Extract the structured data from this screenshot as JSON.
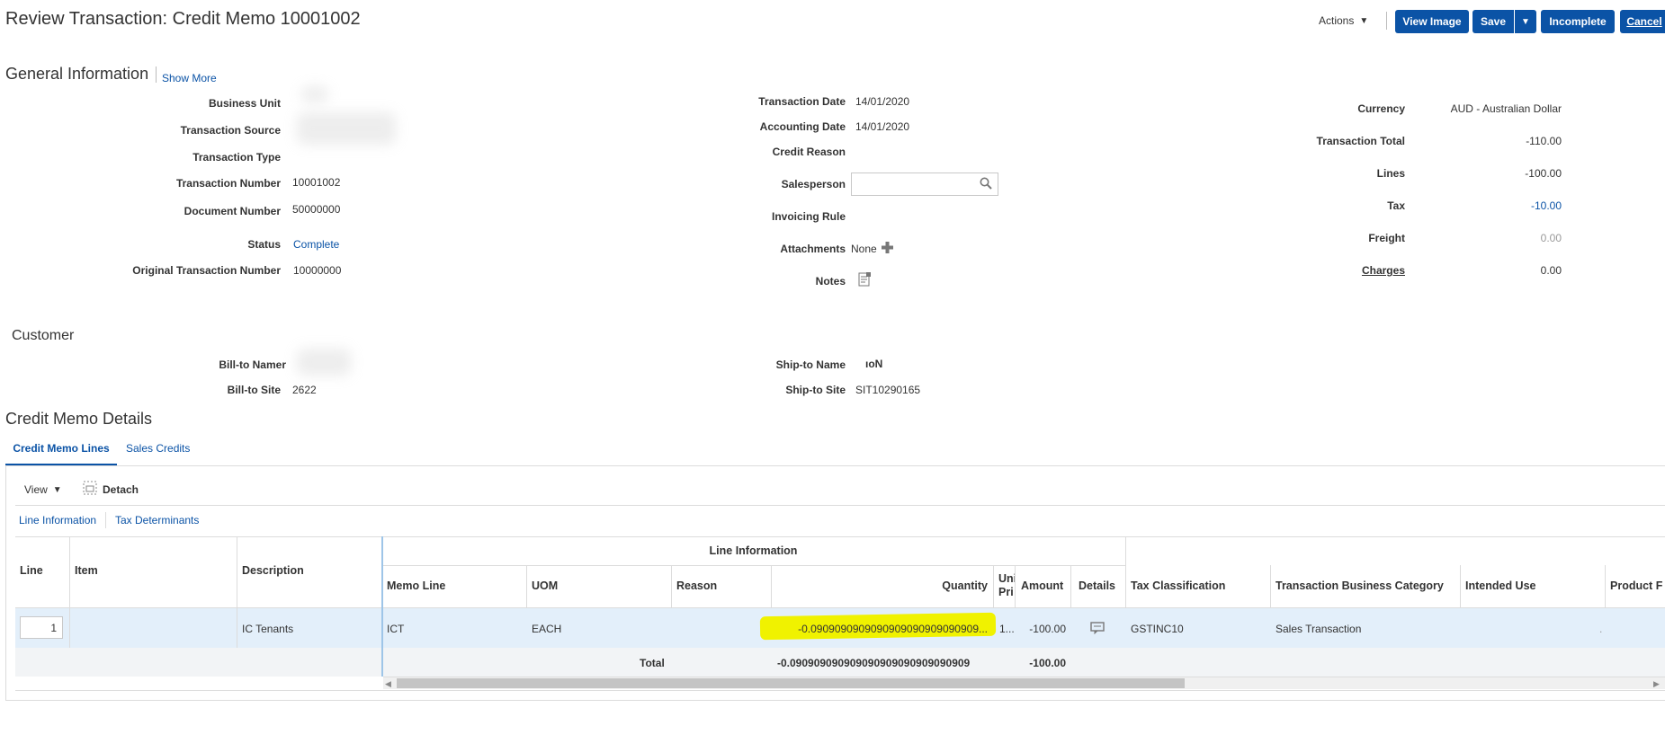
{
  "header": {
    "title": "Review Transaction: Credit Memo 10001002",
    "actions_label": "Actions",
    "buttons": {
      "view_image": "View Image",
      "save": "Save",
      "incomplete": "Incomplete",
      "cancel": "Cancel"
    }
  },
  "general": {
    "title": "General Information",
    "show_more": "Show More",
    "left": {
      "business_unit": {
        "label": "Business Unit",
        "value": ""
      },
      "transaction_source": {
        "label": "Transaction Source",
        "value": ""
      },
      "transaction_type": {
        "label": "Transaction Type",
        "value": ""
      },
      "transaction_number": {
        "label": "Transaction Number",
        "value": "10001002"
      },
      "document_number": {
        "label": "Document Number",
        "value": "50000000"
      },
      "status": {
        "label": "Status",
        "value": "Complete"
      },
      "original_transaction_number": {
        "label": "Original Transaction Number",
        "value": "10000000"
      }
    },
    "middle": {
      "transaction_date": {
        "label": "Transaction Date",
        "value": "14/01/2020"
      },
      "accounting_date": {
        "label": "Accounting Date",
        "value": "14/01/2020"
      },
      "credit_reason": {
        "label": "Credit Reason",
        "value": ""
      },
      "salesperson": {
        "label": "Salesperson",
        "value": ""
      },
      "invoicing_rule": {
        "label": "Invoicing Rule",
        "value": ""
      },
      "attachments": {
        "label": "Attachments",
        "value": "None"
      },
      "notes": {
        "label": "Notes"
      }
    },
    "right": {
      "currency": {
        "label": "Currency",
        "value": "AUD - Australian Dollar"
      },
      "transaction_total": {
        "label": "Transaction Total",
        "value": "-110.00"
      },
      "lines": {
        "label": "Lines",
        "value": "-100.00"
      },
      "tax": {
        "label": "Tax",
        "value": "-10.00"
      },
      "freight": {
        "label": "Freight",
        "value": "0.00"
      },
      "charges": {
        "label": "Charges",
        "value": "0.00"
      }
    }
  },
  "customer": {
    "title": "Customer",
    "bill_to_name": {
      "label": "Bill-to Namer",
      "value": ""
    },
    "bill_to_site": {
      "label": "Bill-to Site",
      "value": "2622"
    },
    "ship_to_name": {
      "label": "Ship-to Name",
      "value": "ıoN"
    },
    "ship_to_site": {
      "label": "Ship-to Site",
      "value": "SIT10290165"
    }
  },
  "details": {
    "title": "Credit Memo Details",
    "tabs": [
      "Credit Memo Lines",
      "Sales Credits"
    ],
    "toolbar": {
      "view": "View",
      "detach": "Detach"
    },
    "subtabs": [
      "Line Information",
      "Tax Determinants"
    ],
    "table": {
      "group_header": "Line Information",
      "frozen_headers": {
        "line": "Line",
        "item": "Item",
        "description": "Description"
      },
      "headers": {
        "memo_line": "Memo Line",
        "uom": "UOM",
        "reason": "Reason",
        "quantity": "Quantity",
        "unit_price": "Uni Pri",
        "amount": "Amount",
        "details": "Details",
        "tax_classification": "Tax Classification",
        "transaction_business_category": "Transaction Business Category",
        "intended_use": "Intended Use",
        "product_f": "Product F"
      },
      "row": {
        "line": "1",
        "item": "",
        "description": "IC Tenants",
        "memo_line": "ICT",
        "uom": "EACH",
        "reason": "",
        "quantity": "-0.0909090909090909090909090909...",
        "unit_price": "1...",
        "amount": "-100.00",
        "tax_classification": "GSTINC10",
        "transaction_business_category": "Sales Transaction",
        "intended_use": "",
        "product_f": "."
      },
      "total": {
        "label": "Total",
        "quantity": "-0.090909090909090909090909090909",
        "amount": "-100.00"
      }
    }
  },
  "colors": {
    "primary_button": "#0b53a6",
    "link": "#0b53a6",
    "selected_row": "#e3effa",
    "highlight": "#f0f200"
  }
}
